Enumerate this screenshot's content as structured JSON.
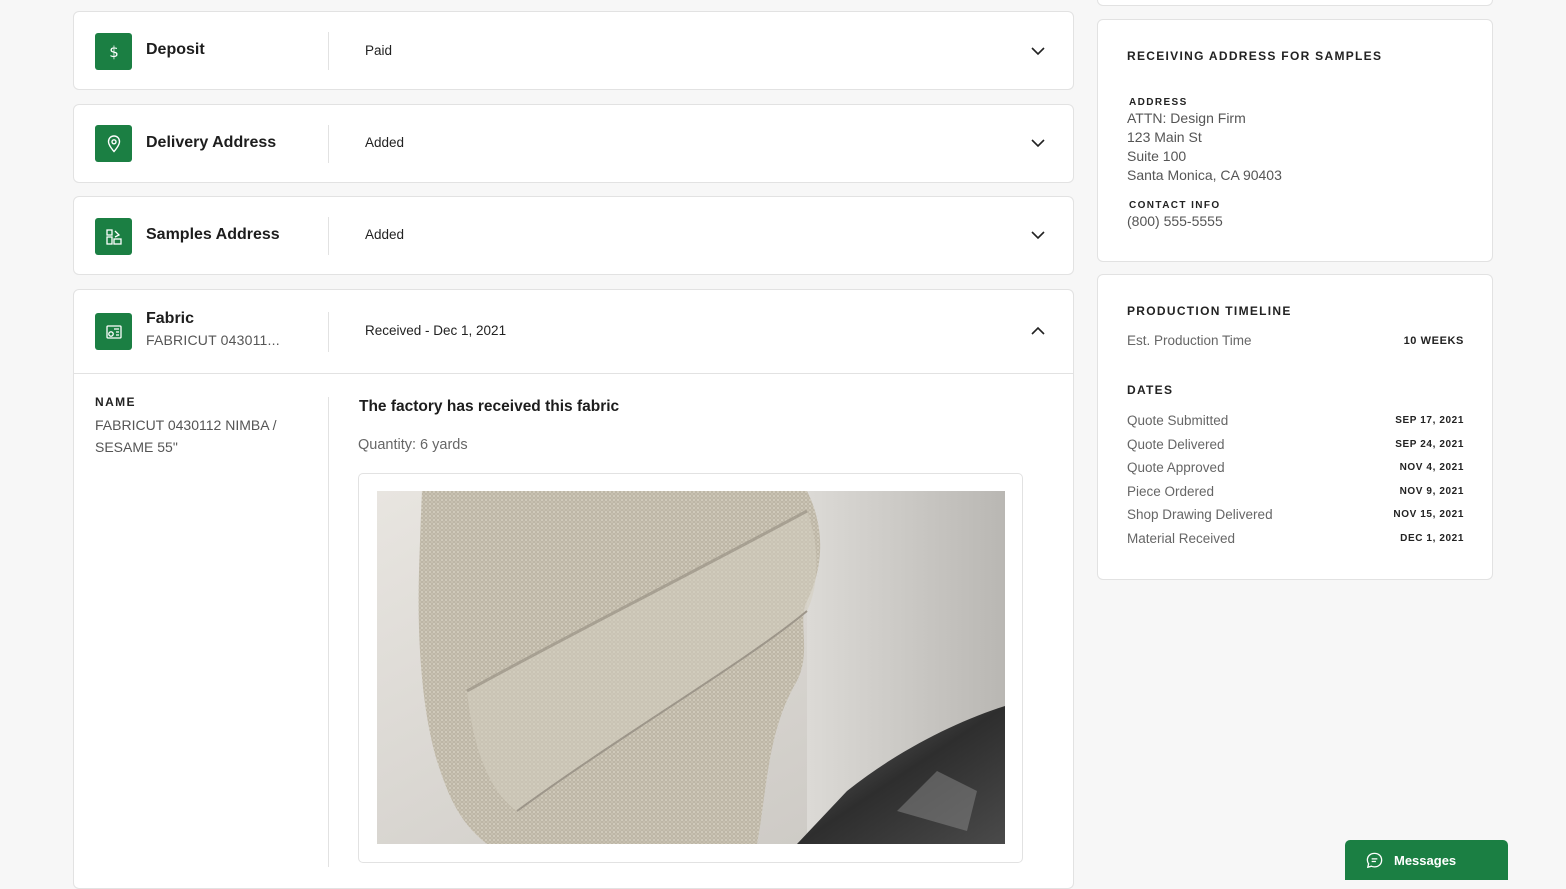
{
  "accordion": {
    "deposit": {
      "title": "Deposit",
      "status": "Paid"
    },
    "delivery": {
      "title": "Delivery Address",
      "status": "Added"
    },
    "samples": {
      "title": "Samples Address",
      "status": "Added"
    },
    "fabric": {
      "title": "Fabric",
      "subtitle": "FABRICUT 043011...",
      "status": "Received - Dec 1, 2021",
      "name_label": "NAME",
      "name_line1": "FABRICUT 0430112 NIMBA /",
      "name_line2": "SESAME 55\"",
      "received_heading": "The factory has received this fabric",
      "quantity": "Quantity: 6 yards"
    }
  },
  "samples_address_card": {
    "title": "RECEIVING ADDRESS FOR SAMPLES",
    "address_label": "ADDRESS",
    "address_lines": [
      "ATTN: Design Firm",
      "123 Main St",
      "Suite 100",
      "Santa Monica, CA 90403"
    ],
    "contact_label": "CONTACT INFO",
    "phone": "(800) 555-5555"
  },
  "production_timeline": {
    "title": "PRODUCTION TIMELINE",
    "est_label": "Est. Production Time",
    "est_value": "10 WEEKS",
    "dates_title": "DATES",
    "dates": [
      {
        "label": "Quote Submitted",
        "date": "SEP 17, 2021"
      },
      {
        "label": "Quote Delivered",
        "date": "SEP 24, 2021"
      },
      {
        "label": "Quote Approved",
        "date": "NOV 4, 2021"
      },
      {
        "label": "Piece Ordered",
        "date": "NOV 9, 2021"
      },
      {
        "label": "Shop Drawing Delivered",
        "date": "NOV 15, 2021"
      },
      {
        "label": "Material Received",
        "date": "DEC 1, 2021"
      }
    ]
  },
  "messages_button": {
    "label": "Messages"
  },
  "icons": {
    "deposit": "dollar-icon",
    "delivery": "location-pin-icon",
    "samples": "swatches-icon",
    "fabric": "fabric-roll-icon",
    "chevron_down": "chevron-down-icon",
    "chevron_up": "chevron-up-icon",
    "messages": "chat-bubble-icon"
  },
  "colors": {
    "accent": "#1b7f43",
    "border": "#e2e2e2",
    "page_bg": "#f7f7f7"
  }
}
